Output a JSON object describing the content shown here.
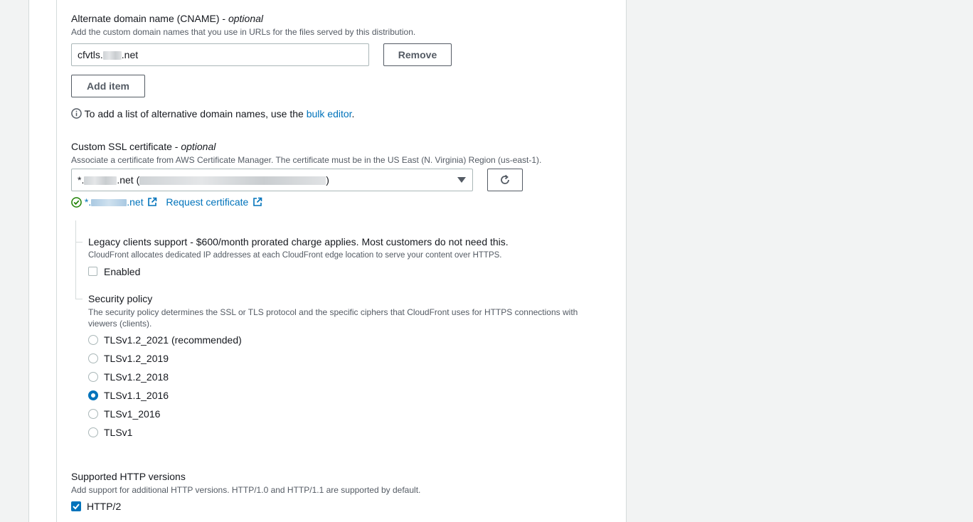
{
  "cname": {
    "label": "Alternate domain name (CNAME) -",
    "optional": "optional",
    "description": "Add the custom domain names that you use in URLs for the files served by this distribution.",
    "value_prefix": "cfvtls.",
    "value_suffix": ".net",
    "remove_label": "Remove",
    "add_item_label": "Add item",
    "info_text": "To add a list of alternative domain names, use the",
    "info_link": "bulk editor",
    "info_end": "."
  },
  "ssl": {
    "label": "Custom SSL certificate -",
    "optional": "optional",
    "description": "Associate a certificate from AWS Certificate Manager. The certificate must be in the US East (N. Virginia) Region (us-east-1).",
    "select_prefix": "*.",
    "select_mid": ".net (",
    "select_end": ")",
    "cert_prefix": "*.",
    "cert_suffix": ".net",
    "request_link": "Request certificate"
  },
  "legacy": {
    "label": "Legacy clients support - $600/month prorated charge applies. Most customers do not need this.",
    "description": "CloudFront allocates dedicated IP addresses at each CloudFront edge location to serve your content over HTTPS.",
    "checkbox_label": "Enabled",
    "checked": false
  },
  "security_policy": {
    "label": "Security policy",
    "description": "The security policy determines the SSL or TLS protocol and the specific ciphers that CloudFront uses for HTTPS connections with viewers (clients).",
    "options": [
      {
        "label": "TLSv1.2_2021 (recommended)",
        "selected": false
      },
      {
        "label": "TLSv1.2_2019",
        "selected": false
      },
      {
        "label": "TLSv1.2_2018",
        "selected": false
      },
      {
        "label": "TLSv1.1_2016",
        "selected": true
      },
      {
        "label": "TLSv1_2016",
        "selected": false
      },
      {
        "label": "TLSv1",
        "selected": false
      }
    ]
  },
  "http": {
    "label": "Supported HTTP versions",
    "description": "Add support for additional HTTP versions. HTTP/1.0 and HTTP/1.1 are supported by default.",
    "checkbox_label": "HTTP/2",
    "checked": true
  },
  "colors": {
    "accent": "#0073bb",
    "success": "#1d8102",
    "border": "#aab7b8"
  }
}
